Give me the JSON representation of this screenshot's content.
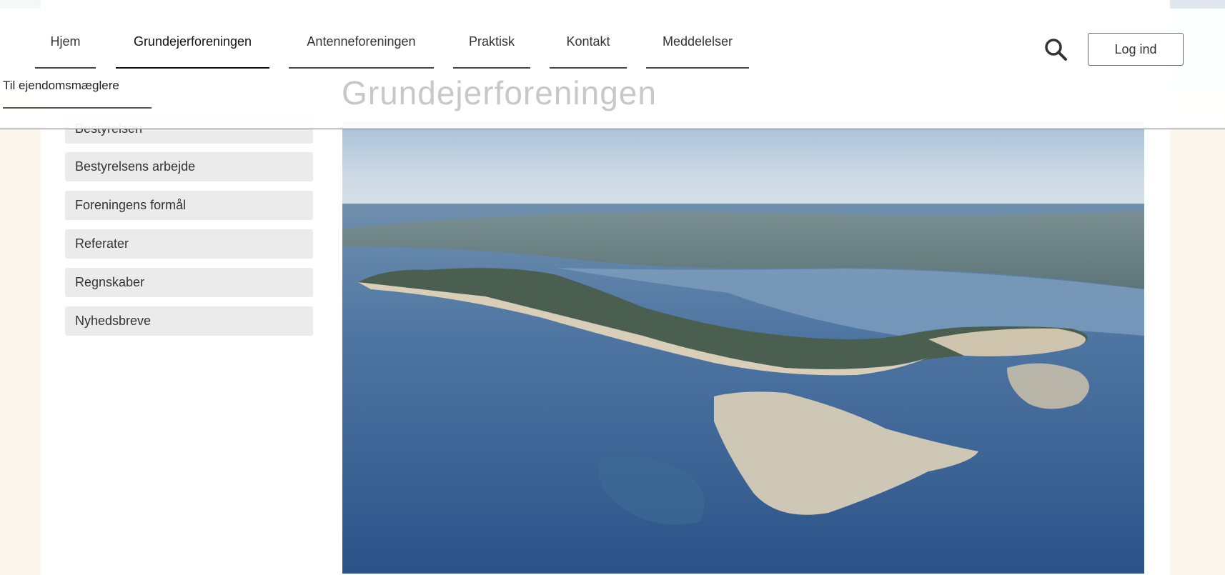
{
  "nav": {
    "items": [
      {
        "label": "Hjem"
      },
      {
        "label": "Grundejerforeningen",
        "active": true
      },
      {
        "label": "Antenneforeningen"
      },
      {
        "label": "Praktisk"
      },
      {
        "label": "Kontakt"
      },
      {
        "label": "Meddelelser"
      }
    ],
    "login_label": "Log ind",
    "search_icon": "search-icon"
  },
  "secondary_link": "Til ejendomsmæglere",
  "page_title": "Grundejerforeningen",
  "sidebar": {
    "items": [
      {
        "label": "Bestyrelsen"
      },
      {
        "label": "Bestyrelsens arbejde"
      },
      {
        "label": "Foreningens formål"
      },
      {
        "label": "Referater"
      },
      {
        "label": "Regnskaber"
      },
      {
        "label": "Nyhedsbreve"
      }
    ]
  },
  "hero": {
    "subject": "aerial photo of island coastline"
  },
  "colors": {
    "background": "#fbf7ec",
    "sidebar_button": "#ebebeb",
    "title": "#c8c8c8"
  }
}
